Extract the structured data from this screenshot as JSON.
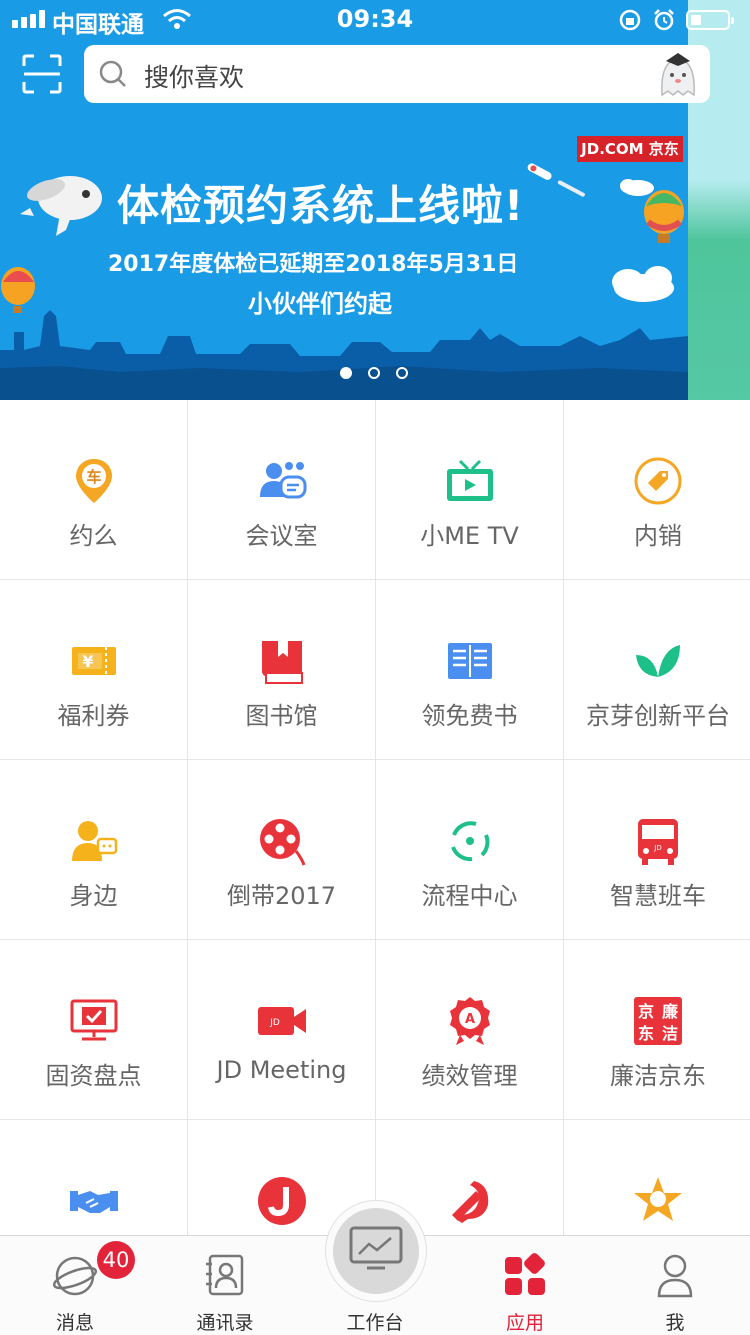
{
  "status_bar": {
    "carrier": "中国联通",
    "time": "09:34"
  },
  "search": {
    "placeholder": "搜你喜欢"
  },
  "banner": {
    "badge": "JD.COM 京东",
    "title": "体检预约系统上线啦!",
    "line2": "2017年度体检已延期至2018年5月31日",
    "line3": "小伙伴们约起",
    "pages": 3,
    "active_page": 1
  },
  "apps": [
    {
      "label": "约么",
      "icon": "car-pin-icon",
      "color": "#f5a623"
    },
    {
      "label": "会议室",
      "icon": "meeting-room-icon",
      "color": "#4a8ff0"
    },
    {
      "label": "小ME TV",
      "icon": "tv-icon",
      "color": "#1ec08a"
    },
    {
      "label": "内销",
      "icon": "tag-icon",
      "color": "#f5a623"
    },
    {
      "label": "福利券",
      "icon": "coupon-icon",
      "color": "#f5b21a"
    },
    {
      "label": "图书馆",
      "icon": "library-book-icon",
      "color": "#e8333a"
    },
    {
      "label": "领免费书",
      "icon": "open-book-icon",
      "color": "#4a8ff0"
    },
    {
      "label": "京芽创新平台",
      "icon": "sprout-icon",
      "color": "#1ec08a"
    },
    {
      "label": "身边",
      "icon": "people-chat-icon",
      "color": "#f5b21a"
    },
    {
      "label": "倒带2017",
      "icon": "film-reel-icon",
      "color": "#e8333a"
    },
    {
      "label": "流程中心",
      "icon": "process-cycle-icon",
      "color": "#1ec08a"
    },
    {
      "label": "智慧班车",
      "icon": "bus-icon",
      "color": "#e8333a"
    },
    {
      "label": "固资盘点",
      "icon": "asset-check-icon",
      "color": "#e8333a"
    },
    {
      "label": "JD Meeting",
      "icon": "video-camera-icon",
      "color": "#e8333a"
    },
    {
      "label": "绩效管理",
      "icon": "award-ribbon-icon",
      "color": "#e8333a"
    },
    {
      "label": "廉洁京东",
      "icon": "integrity-seal-icon",
      "color": "#e8333a"
    },
    {
      "label": "",
      "icon": "handshake-icon",
      "color": "#4a8ff0"
    },
    {
      "label": "",
      "icon": "j-circle-icon",
      "color": "#e8333a"
    },
    {
      "label": "",
      "icon": "party-emblem-icon",
      "color": "#e8333a"
    },
    {
      "label": "",
      "icon": "star-badge-icon",
      "color": "#f5a623"
    }
  ],
  "tabbar": {
    "messages": {
      "label": "消息",
      "badge": "40"
    },
    "contacts": {
      "label": "通讯录"
    },
    "workbench": {
      "label": "工作台"
    },
    "apps": {
      "label": "应用"
    },
    "me": {
      "label": "我"
    }
  }
}
